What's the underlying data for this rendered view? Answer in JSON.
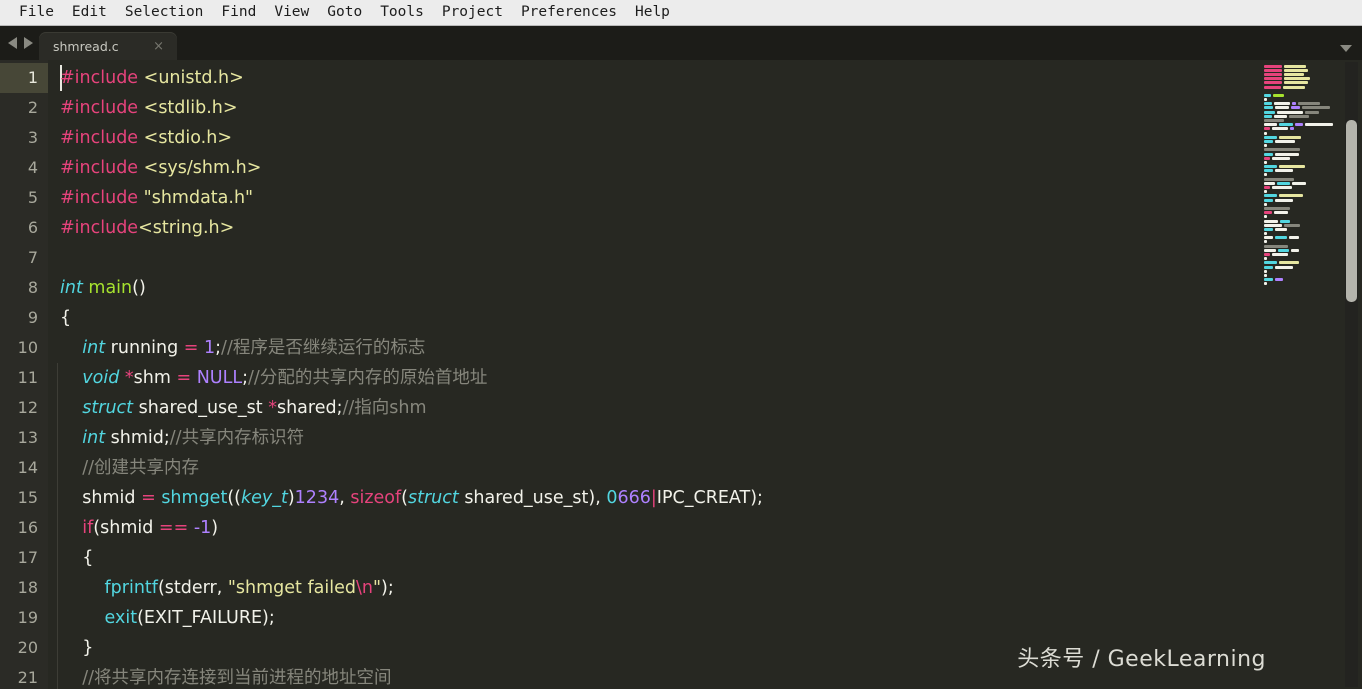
{
  "menubar": {
    "items": [
      "File",
      "Edit",
      "Selection",
      "Find",
      "View",
      "Goto",
      "Tools",
      "Project",
      "Preferences",
      "Help"
    ]
  },
  "tabbar": {
    "nav_back": "◀",
    "nav_forward": "▶",
    "tabs": [
      {
        "label": "shmread.c",
        "close": "×",
        "active": true
      }
    ],
    "menu_chevron": "▼"
  },
  "editor": {
    "active_line": 1,
    "first_visible_line": 1,
    "colors": {
      "background": "#272822",
      "gutter": "#2b2b26",
      "active_line_gutter": "#474737",
      "preprocessor": "#e6437c",
      "string": "#e6e6a0",
      "keyword": "#52d6e0",
      "function": "#a6e22e",
      "comment": "#86867c",
      "operator": "#e6437c",
      "number": "#ae81ff",
      "plain": "#f2f2ea"
    },
    "lines": [
      {
        "n": "1",
        "tokens": [
          {
            "t": "#include",
            "c": "t-pre"
          },
          {
            "t": " ",
            "c": "t-plain"
          },
          {
            "t": "<unistd.h>",
            "c": "t-str"
          }
        ]
      },
      {
        "n": "2",
        "tokens": [
          {
            "t": "#include",
            "c": "t-pre"
          },
          {
            "t": " ",
            "c": "t-plain"
          },
          {
            "t": "<stdlib.h>",
            "c": "t-str"
          }
        ]
      },
      {
        "n": "3",
        "tokens": [
          {
            "t": "#include",
            "c": "t-pre"
          },
          {
            "t": " ",
            "c": "t-plain"
          },
          {
            "t": "<stdio.h>",
            "c": "t-str"
          }
        ]
      },
      {
        "n": "4",
        "tokens": [
          {
            "t": "#include",
            "c": "t-pre"
          },
          {
            "t": " ",
            "c": "t-plain"
          },
          {
            "t": "<sys/shm.h>",
            "c": "t-str"
          }
        ]
      },
      {
        "n": "5",
        "tokens": [
          {
            "t": "#include",
            "c": "t-pre"
          },
          {
            "t": " ",
            "c": "t-plain"
          },
          {
            "t": "\"shmdata.h\"",
            "c": "t-str"
          }
        ]
      },
      {
        "n": "6",
        "tokens": [
          {
            "t": "#include",
            "c": "t-pre"
          },
          {
            "t": "<string.h>",
            "c": "t-str"
          }
        ]
      },
      {
        "n": "7",
        "tokens": []
      },
      {
        "n": "8",
        "tokens": [
          {
            "t": "int",
            "c": "t-kw"
          },
          {
            "t": " ",
            "c": "t-plain"
          },
          {
            "t": "main",
            "c": "t-fn"
          },
          {
            "t": "()",
            "c": "t-plain"
          }
        ]
      },
      {
        "n": "9",
        "tokens": [
          {
            "t": "{",
            "c": "t-plain"
          }
        ]
      },
      {
        "n": "10",
        "tokens": [
          {
            "t": "    ",
            "c": "t-plain"
          },
          {
            "t": "int",
            "c": "t-kw"
          },
          {
            "t": " running ",
            "c": "t-plain"
          },
          {
            "t": "=",
            "c": "t-op"
          },
          {
            "t": " ",
            "c": "t-plain"
          },
          {
            "t": "1",
            "c": "t-num"
          },
          {
            "t": ";",
            "c": "t-plain"
          },
          {
            "t": "//程序是否继续运行的标志",
            "c": "t-com"
          }
        ]
      },
      {
        "n": "11",
        "tokens": [
          {
            "t": "    ",
            "c": "t-plain"
          },
          {
            "t": "void",
            "c": "t-kw"
          },
          {
            "t": " ",
            "c": "t-plain"
          },
          {
            "t": "*",
            "c": "t-op"
          },
          {
            "t": "shm ",
            "c": "t-plain"
          },
          {
            "t": "=",
            "c": "t-op"
          },
          {
            "t": " ",
            "c": "t-plain"
          },
          {
            "t": "NULL",
            "c": "t-num"
          },
          {
            "t": ";",
            "c": "t-plain"
          },
          {
            "t": "//分配的共享内存的原始首地址",
            "c": "t-com"
          }
        ]
      },
      {
        "n": "12",
        "tokens": [
          {
            "t": "    ",
            "c": "t-plain"
          },
          {
            "t": "struct",
            "c": "t-kw"
          },
          {
            "t": " shared_use_st ",
            "c": "t-plain"
          },
          {
            "t": "*",
            "c": "t-op"
          },
          {
            "t": "shared;",
            "c": "t-plain"
          },
          {
            "t": "//指向shm",
            "c": "t-com"
          }
        ]
      },
      {
        "n": "13",
        "tokens": [
          {
            "t": "    ",
            "c": "t-plain"
          },
          {
            "t": "int",
            "c": "t-kw"
          },
          {
            "t": " shmid;",
            "c": "t-plain"
          },
          {
            "t": "//共享内存标识符",
            "c": "t-com"
          }
        ]
      },
      {
        "n": "14",
        "tokens": [
          {
            "t": "    ",
            "c": "t-plain"
          },
          {
            "t": "//创建共享内存",
            "c": "t-com"
          }
        ]
      },
      {
        "n": "15",
        "tokens": [
          {
            "t": "    ",
            "c": "t-plain"
          },
          {
            "t": "shmid ",
            "c": "t-plain"
          },
          {
            "t": "=",
            "c": "t-op"
          },
          {
            "t": " ",
            "c": "t-plain"
          },
          {
            "t": "shmget",
            "c": "t-call"
          },
          {
            "t": "((",
            "c": "t-plain"
          },
          {
            "t": "key_t",
            "c": "t-kw"
          },
          {
            "t": ")",
            "c": "t-plain"
          },
          {
            "t": "1234",
            "c": "t-num"
          },
          {
            "t": ", ",
            "c": "t-plain"
          },
          {
            "t": "sizeof",
            "c": "t-op"
          },
          {
            "t": "(",
            "c": "t-plain"
          },
          {
            "t": "struct",
            "c": "t-kw"
          },
          {
            "t": " shared_use_st), ",
            "c": "t-plain"
          },
          {
            "t": "0",
            "c": "t-num0"
          },
          {
            "t": "666",
            "c": "t-num"
          },
          {
            "t": "|",
            "c": "t-op"
          },
          {
            "t": "IPC_CREAT);",
            "c": "t-plain"
          }
        ]
      },
      {
        "n": "16",
        "tokens": [
          {
            "t": "    ",
            "c": "t-plain"
          },
          {
            "t": "if",
            "c": "t-op"
          },
          {
            "t": "(shmid ",
            "c": "t-plain"
          },
          {
            "t": "==",
            "c": "t-op"
          },
          {
            "t": " ",
            "c": "t-plain"
          },
          {
            "t": "-1",
            "c": "t-num"
          },
          {
            "t": ")",
            "c": "t-plain"
          }
        ]
      },
      {
        "n": "17",
        "tokens": [
          {
            "t": "    {",
            "c": "t-plain"
          }
        ]
      },
      {
        "n": "18",
        "tokens": [
          {
            "t": "        ",
            "c": "t-plain"
          },
          {
            "t": "fprintf",
            "c": "t-call"
          },
          {
            "t": "(stderr, ",
            "c": "t-plain"
          },
          {
            "t": "\"shmget failed",
            "c": "t-str"
          },
          {
            "t": "\\n",
            "c": "t-esc"
          },
          {
            "t": "\"",
            "c": "t-str"
          },
          {
            "t": ");",
            "c": "t-plain"
          }
        ]
      },
      {
        "n": "19",
        "tokens": [
          {
            "t": "        ",
            "c": "t-plain"
          },
          {
            "t": "exit",
            "c": "t-call"
          },
          {
            "t": "(EXIT_FAILURE);",
            "c": "t-plain"
          }
        ]
      },
      {
        "n": "20",
        "tokens": [
          {
            "t": "    }",
            "c": "t-plain"
          }
        ]
      },
      {
        "n": "21",
        "tokens": [
          {
            "t": "    ",
            "c": "t-plain"
          },
          {
            "t": "//将共享内存连接到当前进程的地址空间",
            "c": "t-com"
          }
        ]
      }
    ]
  },
  "minimap": {
    "rows": [
      [
        [
          "#e6437c",
          18
        ],
        [
          "#e6e6a0",
          22
        ]
      ],
      [
        [
          "#e6437c",
          18
        ],
        [
          "#e6e6a0",
          24
        ]
      ],
      [
        [
          "#e6437c",
          18
        ],
        [
          "#e6e6a0",
          20
        ]
      ],
      [
        [
          "#e6437c",
          18
        ],
        [
          "#e6e6a0",
          26
        ]
      ],
      [
        [
          "#e6437c",
          18
        ],
        [
          "#e6e6a0",
          24
        ]
      ],
      [
        [
          "#e6437c",
          17
        ],
        [
          "#e6e6a0",
          22
        ]
      ],
      [],
      [
        [
          "#52d6e0",
          7
        ],
        [
          "#a6e22e",
          11
        ]
      ],
      [
        [
          "#f2f2ea",
          3
        ]
      ],
      [
        [
          "#52d6e0",
          8
        ],
        [
          "#f2f2ea",
          16
        ],
        [
          "#ae81ff",
          4
        ],
        [
          "#86867c",
          22
        ]
      ],
      [
        [
          "#52d6e0",
          9
        ],
        [
          "#f2f2ea",
          14
        ],
        [
          "#ae81ff",
          9
        ],
        [
          "#86867c",
          28
        ]
      ],
      [
        [
          "#52d6e0",
          11
        ],
        [
          "#f2f2ea",
          26
        ],
        [
          "#86867c",
          14
        ]
      ],
      [
        [
          "#52d6e0",
          8
        ],
        [
          "#f2f2ea",
          13
        ],
        [
          "#86867c",
          20
        ]
      ],
      [
        [
          "#86867c",
          20
        ]
      ],
      [
        [
          "#f2f2ea",
          13
        ],
        [
          "#52d6e0",
          14
        ],
        [
          "#ae81ff",
          8
        ],
        [
          "#f2f2ea",
          28
        ]
      ],
      [
        [
          "#e6437c",
          6
        ],
        [
          "#f2f2ea",
          16
        ],
        [
          "#ae81ff",
          4
        ]
      ],
      [
        [
          "#f2f2ea",
          3
        ]
      ],
      [
        [
          "#52d6e0",
          13
        ],
        [
          "#e6e6a0",
          22
        ]
      ],
      [
        [
          "#52d6e0",
          9
        ],
        [
          "#f2f2ea",
          20
        ]
      ],
      [
        [
          "#f2f2ea",
          3
        ]
      ],
      [
        [
          "#86867c",
          36
        ]
      ],
      [
        [
          "#52d6e0",
          9
        ],
        [
          "#f2f2ea",
          24
        ]
      ],
      [
        [
          "#e6437c",
          6
        ],
        [
          "#f2f2ea",
          18
        ]
      ],
      [
        [
          "#f2f2ea",
          3
        ]
      ],
      [
        [
          "#52d6e0",
          13
        ],
        [
          "#e6e6a0",
          26
        ]
      ],
      [
        [
          "#52d6e0",
          9
        ],
        [
          "#f2f2ea",
          18
        ]
      ],
      [
        [
          "#f2f2ea",
          3
        ]
      ],
      [
        [
          "#86867c",
          30
        ]
      ],
      [
        [
          "#f2f2ea",
          11
        ],
        [
          "#52d6e0",
          13
        ],
        [
          "#f2f2ea",
          14
        ]
      ],
      [
        [
          "#e6437c",
          6
        ],
        [
          "#f2f2ea",
          20
        ]
      ],
      [
        [
          "#f2f2ea",
          3
        ]
      ],
      [
        [
          "#52d6e0",
          13
        ],
        [
          "#e6e6a0",
          24
        ]
      ],
      [
        [
          "#52d6e0",
          9
        ],
        [
          "#f2f2ea",
          18
        ]
      ],
      [
        [
          "#f2f2ea",
          3
        ]
      ],
      [
        [
          "#86867c",
          26
        ]
      ],
      [
        [
          "#e6437c",
          8
        ],
        [
          "#f2f2ea",
          14
        ]
      ],
      [
        [
          "#f2f2ea",
          3
        ]
      ],
      [
        [
          "#f2f2ea",
          14
        ],
        [
          "#52d6e0",
          10
        ]
      ],
      [
        [
          "#f2f2ea",
          18
        ],
        [
          "#86867c",
          16
        ]
      ],
      [
        [
          "#52d6e0",
          9
        ],
        [
          "#f2f2ea",
          12
        ]
      ],
      [
        [
          "#f2f2ea",
          3
        ]
      ],
      [
        [
          "#f2f2ea",
          9
        ],
        [
          "#52d6e0",
          12
        ],
        [
          "#f2f2ea",
          10
        ]
      ],
      [
        [
          "#f2f2ea",
          3
        ]
      ],
      [
        [
          "#86867c",
          24
        ]
      ],
      [
        [
          "#f2f2ea",
          12
        ],
        [
          "#52d6e0",
          11
        ],
        [
          "#f2f2ea",
          8
        ]
      ],
      [
        [
          "#e6437c",
          6
        ],
        [
          "#f2f2ea",
          16
        ]
      ],
      [
        [
          "#f2f2ea",
          3
        ]
      ],
      [
        [
          "#52d6e0",
          13
        ],
        [
          "#e6e6a0",
          20
        ]
      ],
      [
        [
          "#52d6e0",
          9
        ],
        [
          "#f2f2ea",
          18
        ]
      ],
      [
        [
          "#f2f2ea",
          3
        ]
      ],
      [
        [
          "#f2f2ea",
          3
        ]
      ],
      [
        [
          "#52d6e0",
          9
        ],
        [
          "#ae81ff",
          8
        ]
      ],
      [
        [
          "#f2f2ea",
          3
        ]
      ]
    ]
  },
  "watermark": {
    "text": "头条号 / GeekLearning"
  }
}
